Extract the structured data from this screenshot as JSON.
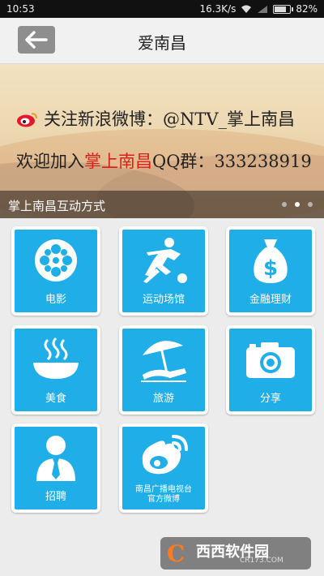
{
  "status_bar": {
    "time": "10:53",
    "network_speed": "16.3K/s",
    "battery": "82%"
  },
  "header": {
    "title": "爱南昌"
  },
  "banner": {
    "line1_prefix": "关注新浪微博：",
    "line1_handle": "@NTV_掌上南昌",
    "line2_prefix": "欢迎加入",
    "line2_highlight": "掌上南昌",
    "line2_suffix": "QQ群：",
    "line2_number": "333238919",
    "caption": "掌上南昌互动方式",
    "slides": 3,
    "active_slide": 2
  },
  "tiles": [
    {
      "label": "电影",
      "icon": "film-reel-icon"
    },
    {
      "label": "运动场馆",
      "icon": "soccer-player-icon"
    },
    {
      "label": "金融理财",
      "icon": "money-bag-icon"
    },
    {
      "label": "美食",
      "icon": "hot-bowl-icon"
    },
    {
      "label": "旅游",
      "icon": "beach-umbrella-icon"
    },
    {
      "label": "分享",
      "icon": "camera-icon"
    },
    {
      "label": "招聘",
      "icon": "businessman-icon"
    },
    {
      "label": "南昌广播电视台官方微博",
      "line1": "南昌广播电视台",
      "line2": "官方微博",
      "icon": "weibo-icon"
    }
  ],
  "watermark": {
    "brand": "西西软件园",
    "url": "CR173.COM"
  },
  "colors": {
    "tile": "#1faee8",
    "highlight": "#d6201b"
  }
}
